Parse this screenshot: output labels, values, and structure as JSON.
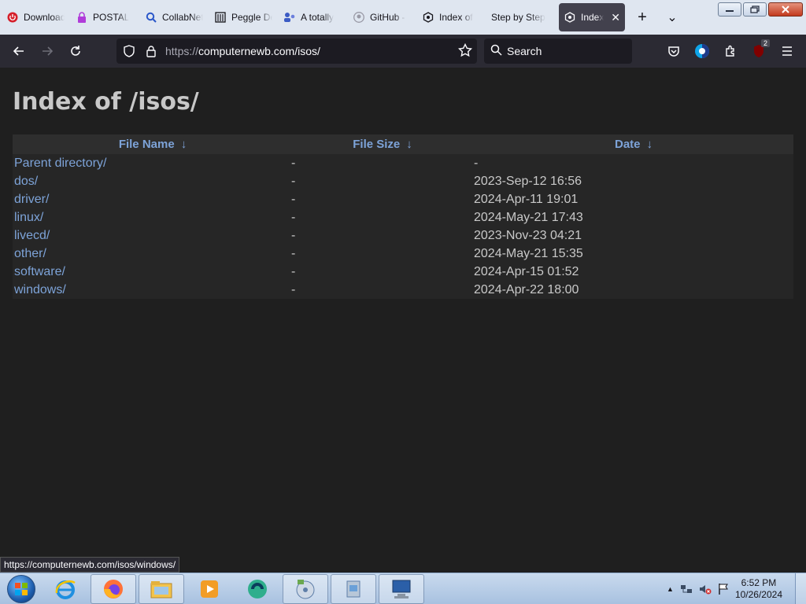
{
  "browser": {
    "tabs": [
      {
        "title": "Download",
        "icon": "red-power-icon"
      },
      {
        "title": "POSTAL",
        "icon": "purple-lock-icon"
      },
      {
        "title": "CollabNet",
        "icon": "blue-search-icon"
      },
      {
        "title": "Peggle Deluxe",
        "icon": "archive-icon"
      },
      {
        "title": "A totally",
        "icon": "people-icon"
      },
      {
        "title": "GitHub -",
        "icon": "github-icon"
      },
      {
        "title": "Index of",
        "icon": "server-icon"
      },
      {
        "title": "Step by Step",
        "icon": ""
      },
      {
        "title": "Index",
        "icon": "server-icon",
        "active": true
      }
    ],
    "new_tab": "+",
    "tab_list": "⌄",
    "window_controls": {
      "minimize": "▭",
      "maximize": "❐",
      "close": "✕"
    }
  },
  "navbar": {
    "url_protocol": "https://",
    "url_host_path": "computernewb.com/isos/",
    "search_placeholder": "Search",
    "extension_badge": "2"
  },
  "page": {
    "title": "Index of /isos/",
    "headers": {
      "name": "File Name",
      "size": "File Size",
      "date": "Date",
      "sort_arrow": "↓"
    },
    "rows": [
      {
        "name": "Parent directory/",
        "size": "-",
        "date": "-"
      },
      {
        "name": "dos/",
        "size": "-",
        "date": "2023-Sep-12 16:56"
      },
      {
        "name": "driver/",
        "size": "-",
        "date": "2024-Apr-11 19:01"
      },
      {
        "name": "linux/",
        "size": "-",
        "date": "2024-May-21 17:43"
      },
      {
        "name": "livecd/",
        "size": "-",
        "date": "2023-Nov-23 04:21"
      },
      {
        "name": "other/",
        "size": "-",
        "date": "2024-May-21 15:35"
      },
      {
        "name": "software/",
        "size": "-",
        "date": "2024-Apr-15 01:52"
      },
      {
        "name": "windows/",
        "size": "-",
        "date": "2024-Apr-22 18:00"
      }
    ]
  },
  "status_url": "https://computernewb.com/isos/windows/",
  "taskbar": {
    "apps": [
      "firefox-icon",
      "internet-explorer-icon",
      "file-explorer-icon",
      "media-player-icon",
      "app-icon",
      "disc-tool-icon",
      "installer-icon",
      "computer-icon"
    ],
    "time": "6:52 PM",
    "date": "10/26/2024",
    "tray_arrow": "▲"
  },
  "colors": {
    "link": "#7da3d8",
    "page_bg": "#1f1f1f",
    "toolbar_bg": "#2b2a33"
  }
}
